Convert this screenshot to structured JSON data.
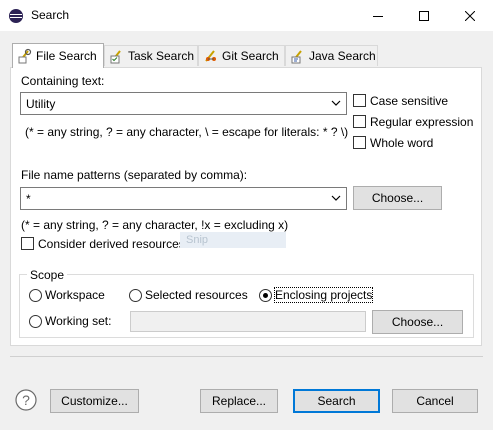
{
  "window": {
    "title": "Search",
    "minimize_icon": "minimize-icon",
    "maximize_icon": "maximize-icon",
    "close_icon": "close-icon"
  },
  "tabs": [
    {
      "label": "File Search",
      "icon": "file-search-icon",
      "active": true
    },
    {
      "label": "Task Search",
      "icon": "task-search-icon",
      "active": false
    },
    {
      "label": "Git Search",
      "icon": "git-search-icon",
      "active": false
    },
    {
      "label": "Java Search",
      "icon": "java-search-icon",
      "active": false
    }
  ],
  "containing_text": {
    "label": "Containing text:",
    "value": "Utility",
    "hint": "(* = any string, ? = any character, \\ = escape for literals: * ? \\)"
  },
  "options": {
    "case_sensitive": {
      "label": "Case sensitive",
      "checked": false
    },
    "regular_expression": {
      "label": "Regular expression",
      "checked": false
    },
    "whole_word": {
      "label": "Whole word",
      "checked": false
    }
  },
  "file_patterns": {
    "label": "File name patterns (separated by comma):",
    "value": "*",
    "hint": "(* = any string, ? = any character, !x = excluding x)",
    "choose_label": "Choose..."
  },
  "derived": {
    "label": "Consider derived resources",
    "checked": false
  },
  "snip_overlay": "Snip",
  "scope": {
    "label": "Scope",
    "options": [
      {
        "label": "Workspace",
        "selected": false
      },
      {
        "label": "Selected resources",
        "selected": false
      },
      {
        "label": "Enclosing projects",
        "selected": true
      },
      {
        "label": "Working set:",
        "selected": false
      }
    ],
    "working_set_value": "",
    "choose_label": "Choose..."
  },
  "footer": {
    "help_icon": "help-icon",
    "customize_label": "Customize...",
    "replace_label": "Replace...",
    "search_label": "Search",
    "cancel_label": "Cancel"
  },
  "colors": {
    "accent": "#0078d7",
    "eclipse_purple": "#2c2255"
  }
}
